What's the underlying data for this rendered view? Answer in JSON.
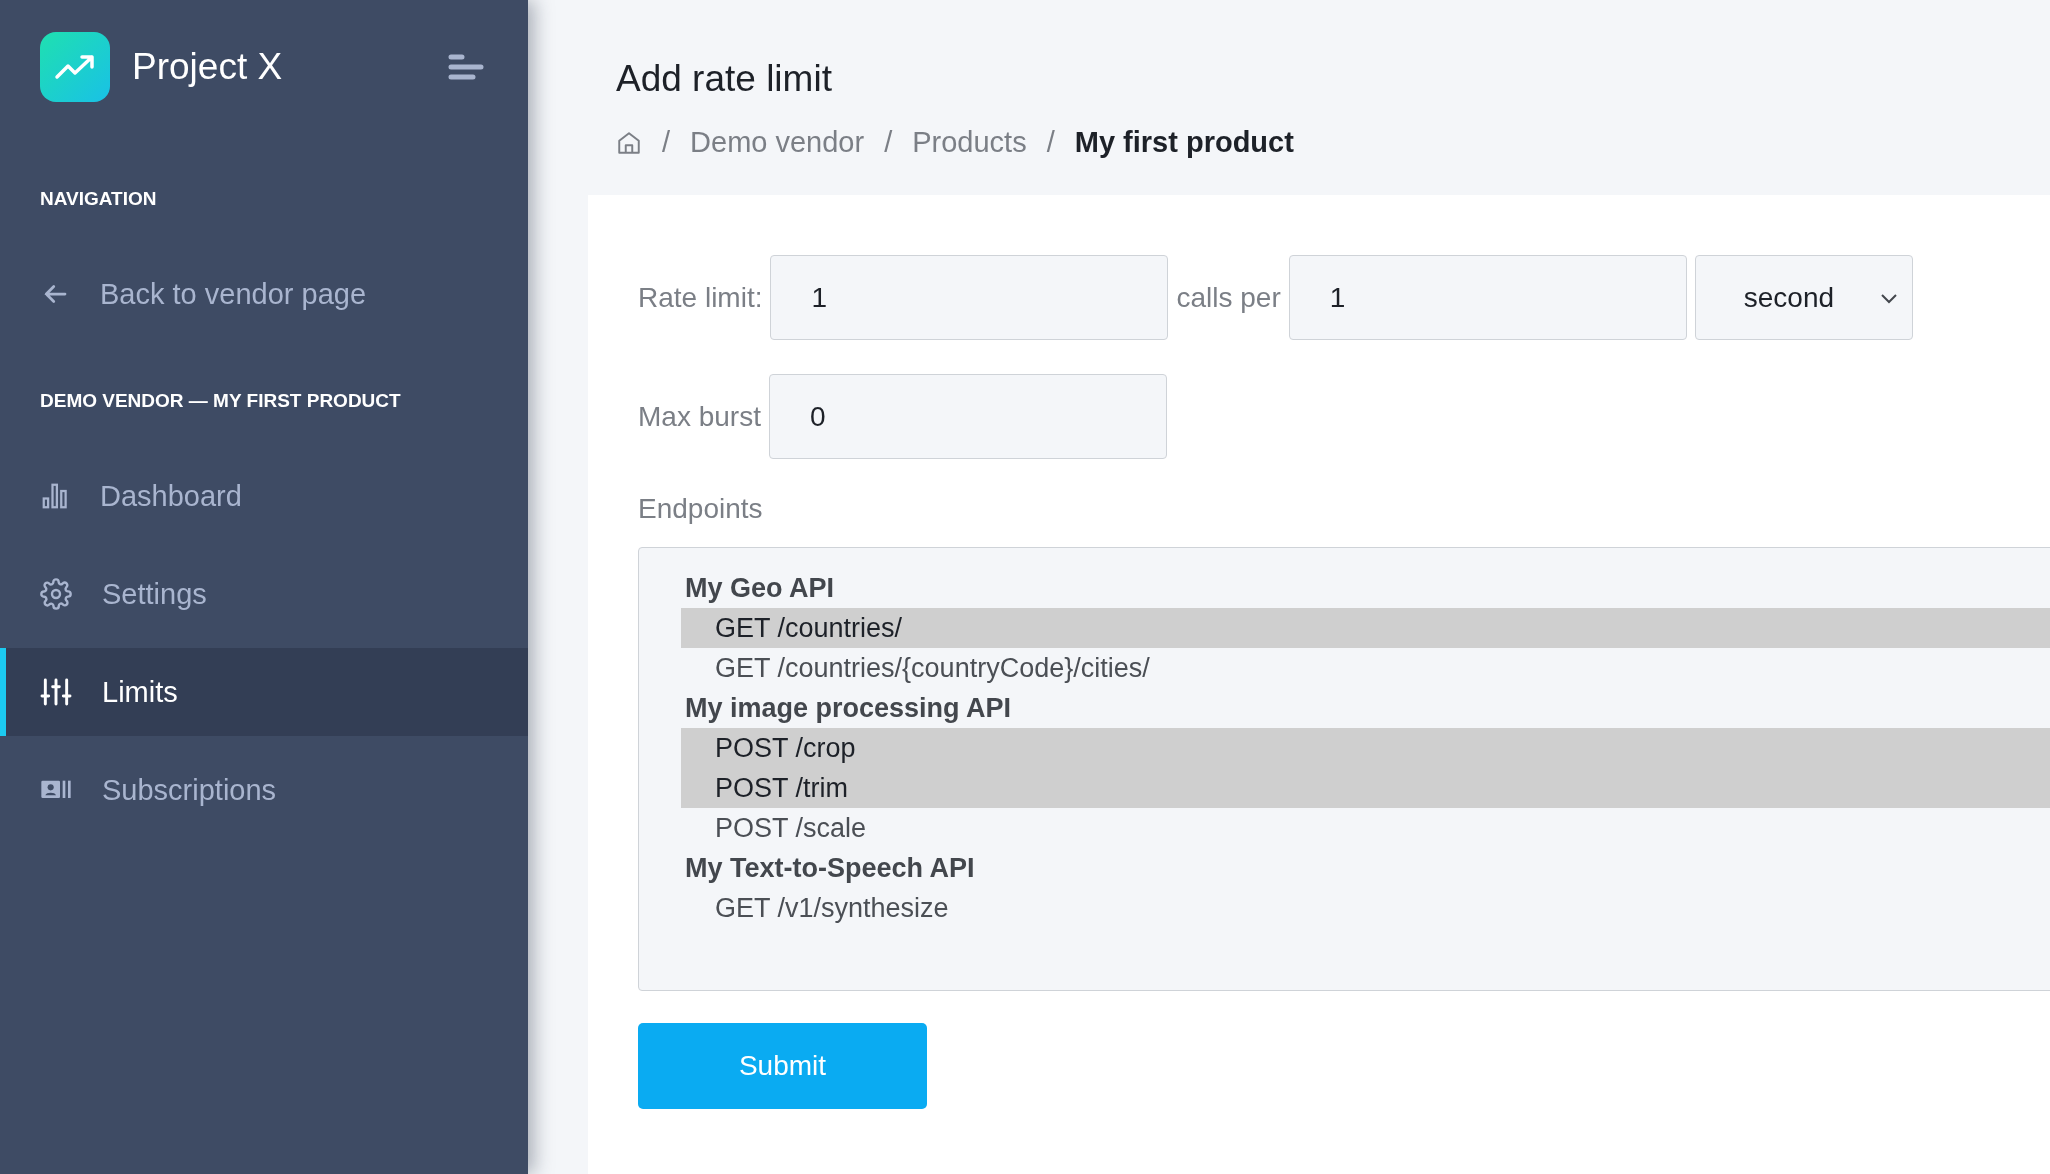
{
  "sidebar": {
    "brand": "Project X",
    "sections": [
      {
        "heading": "NAVIGATION",
        "items": [
          {
            "label": "Back to vendor page",
            "kind": "arrow",
            "selected": false
          }
        ]
      },
      {
        "heading": "DEMO VENDOR — MY FIRST PRODUCT",
        "items": [
          {
            "label": "Dashboard",
            "kind": "bars",
            "selected": false
          },
          {
            "label": "Settings",
            "kind": "gear",
            "selected": false
          },
          {
            "label": "Limits",
            "kind": "sliders",
            "selected": true
          },
          {
            "label": "Subscriptions",
            "kind": "card",
            "selected": false
          }
        ]
      }
    ]
  },
  "page_title": "Add rate limit",
  "breadcrumb": [
    {
      "label": "Demo vendor",
      "current": false
    },
    {
      "label": "Products",
      "current": false
    },
    {
      "label": "My first product",
      "current": true
    }
  ],
  "breadcrumb_separator": "/",
  "form": {
    "rate_limit": {
      "label": "Rate limit:",
      "value": "1"
    },
    "calls_per": {
      "label": "calls per",
      "value": "1"
    },
    "period": {
      "value": "second"
    },
    "max_burst": {
      "label": "Max burst",
      "value": "0"
    },
    "endpoints": {
      "label": "Endpoints",
      "groups": [
        {
          "name": "My Geo API",
          "options": [
            {
              "label": "GET /countries/",
              "selected": true
            },
            {
              "label": "GET /countries/{countryCode}/cities/",
              "selected": false
            }
          ]
        },
        {
          "name": "My image processing API",
          "options": [
            {
              "label": "POST /crop",
              "selected": true
            },
            {
              "label": "POST /trim",
              "selected": true
            },
            {
              "label": "POST /scale",
              "selected": false
            }
          ]
        },
        {
          "name": "My Text-to-Speech API",
          "options": [
            {
              "label": "GET /v1/synthesize",
              "selected": false
            }
          ]
        }
      ]
    },
    "submit": "Submit"
  }
}
